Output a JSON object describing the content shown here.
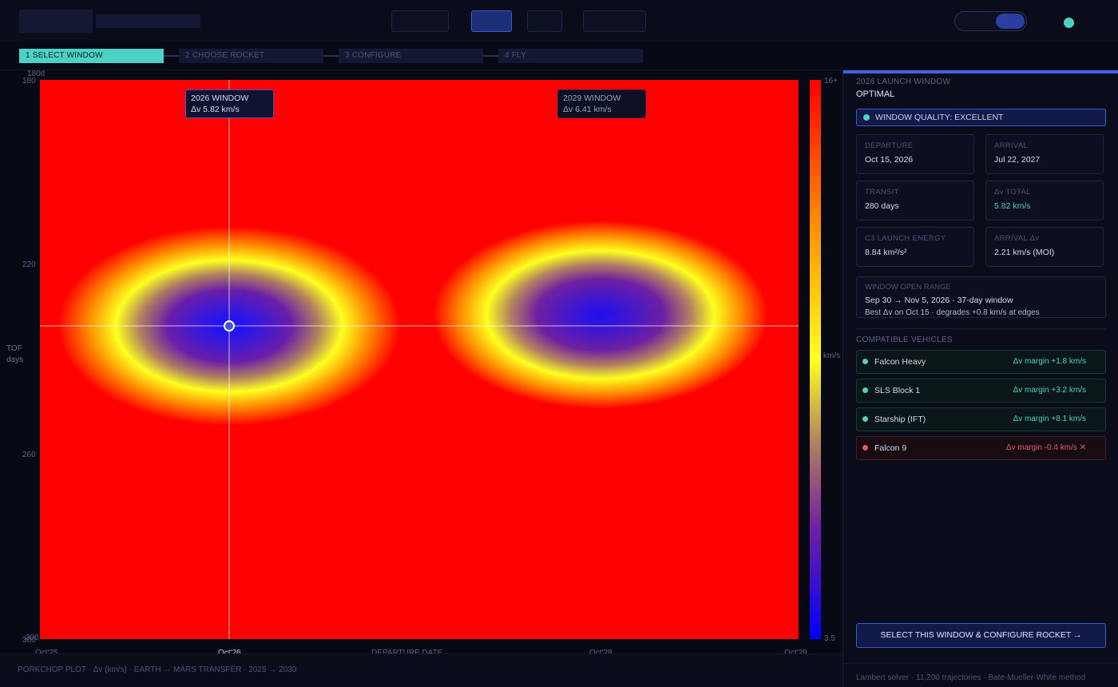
{
  "steps": [
    "1  SELECT WINDOW",
    "2  CHOOSE ROCKET",
    "3  CONFIGURE",
    "4  FLY"
  ],
  "plot": {
    "y_ticks": [
      "180d",
      "180",
      "220",
      "260",
      "300",
      "300"
    ],
    "x_ticks": [
      "Oct'25",
      "Oct'26",
      "Oct'28",
      "Oct'29"
    ],
    "x_axis_label": "DEPARTURE DATE",
    "y_axis_label_1": "TOF",
    "y_axis_label_2": "days",
    "colorbar_max": "16+",
    "colorbar_min": "3.5",
    "colorbar_unit": "km/s",
    "window1_title": "2026 WINDOW",
    "window1_dv": "Δv 5.82 km/s",
    "window2_title": "2029 WINDOW",
    "window2_dv": "Δv 6.41 km/s",
    "footer": "PORKCHOP PLOT · Δv (km/s) · EARTH → MARS TRANSFER · 2025 → 2030",
    "colors": {
      "accent": "#4ed1c4",
      "brand": "#3e63e0",
      "high": "#ff0000",
      "low": "#0000ff"
    }
  },
  "side": {
    "kicker": "2026 LAUNCH WINDOW",
    "title": "OPTIMAL",
    "quality": "WINDOW QUALITY: EXCELLENT",
    "departure_k": "DEPARTURE",
    "departure_v": "Oct 15, 2026",
    "arrival_k": "ARRIVAL",
    "arrival_v": "Jul 22, 2027",
    "transit_k": "TRANSIT",
    "transit_v": "280 days",
    "dv_k": "Δv TOTAL",
    "dv_v": "5.82 km/s",
    "c3_k": "C3 LAUNCH ENERGY",
    "c3_v": "8.84 km²/s²",
    "arrdv_k": "ARRIVAL Δv",
    "arrdv_v": "2.21 km/s (MOI)",
    "range_k": "WINDOW OPEN RANGE",
    "range_v": "Sep 30 → Nov 5, 2026  · 37-day window",
    "range_s": "Best Δv on Oct 15 · degrades +0.8 km/s at edges",
    "vehicles_lbl": "COMPATIBLE VEHICLES",
    "vehicles": [
      {
        "name": "Falcon Heavy",
        "margin": "Δv margin +1.8 km/s"
      },
      {
        "name": "SLS Block 1",
        "margin": "Δv margin +3.2 km/s"
      },
      {
        "name": "Starship (IFT)",
        "margin": "Δv margin +8.1 km/s"
      },
      {
        "name": "Falcon 9",
        "margin": "Δv margin -0.4 km/s ✕"
      }
    ],
    "cta": "SELECT THIS WINDOW & CONFIGURE ROCKET →",
    "footer": "Lambert solver · 11,200 trajectories · Bate-Mueller-White method"
  }
}
